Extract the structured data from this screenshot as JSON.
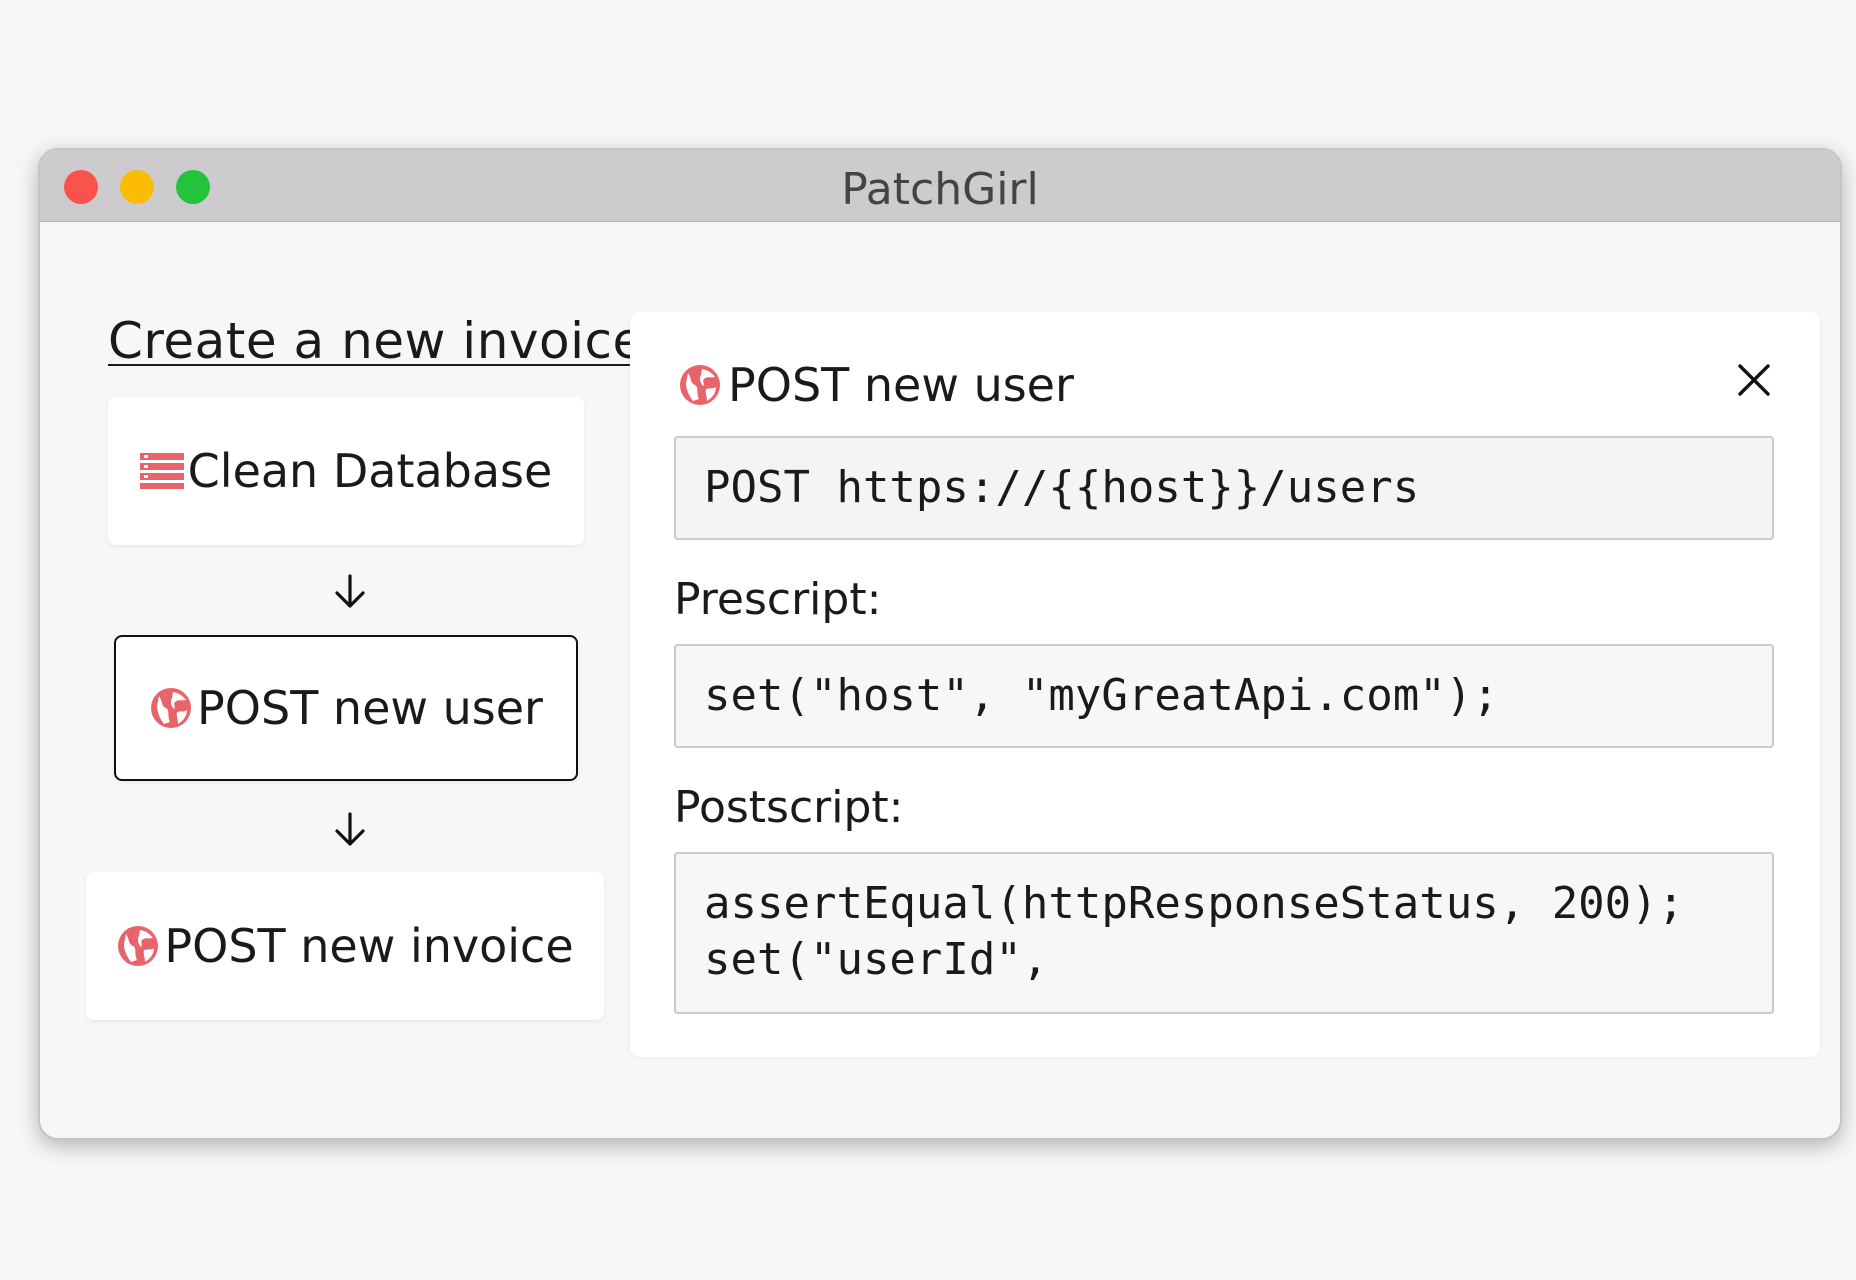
{
  "window": {
    "title": "PatchGirl"
  },
  "flow": {
    "title": "Create a new invoice",
    "steps": [
      {
        "label": "Clean Database",
        "icon": "database-icon"
      },
      {
        "label": "POST new user",
        "icon": "globe-icon",
        "selected": true
      },
      {
        "label": "POST new invoice",
        "icon": "globe-icon"
      }
    ]
  },
  "detail": {
    "title": "POST new user",
    "request": "POST https://{{host}}/users",
    "prescript_label": "Prescript:",
    "prescript": "set(\"host\", \"myGreatApi.com\");",
    "postscript_label": "Postscript:",
    "postscript": "assertEqual(httpResponseStatus, 200);\nset(\"userId\","
  },
  "colors": {
    "accent": "#e8646a",
    "traffic_red": "#fb524b",
    "traffic_yellow": "#fbbc05",
    "traffic_green": "#21c43a"
  }
}
